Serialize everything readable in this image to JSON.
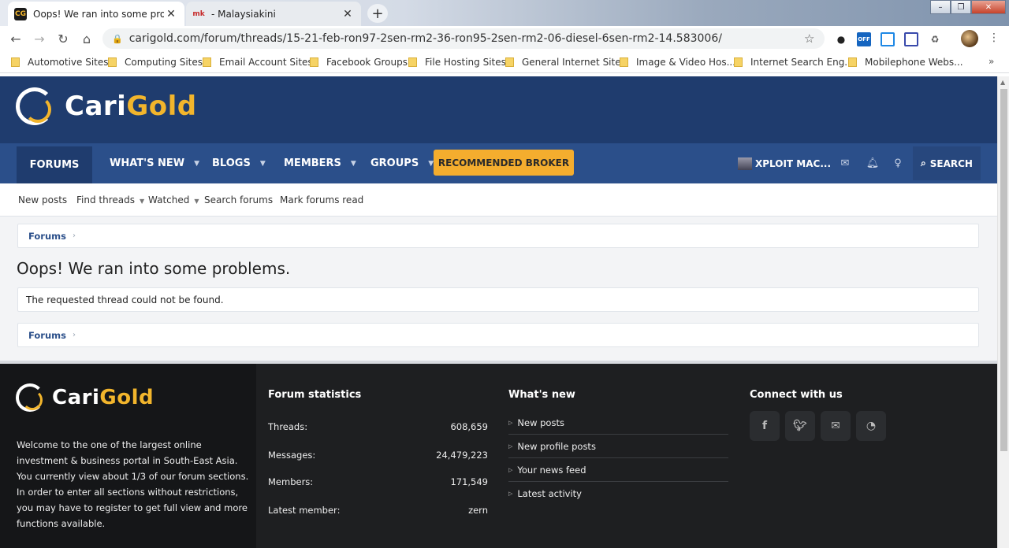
{
  "browser": {
    "tabs": [
      {
        "title": "Oops! We ran into some problem",
        "favicon": "CG"
      },
      {
        "title": "- Malaysiakini",
        "favicon": "mk"
      }
    ],
    "new_tab_glyph": "+",
    "close_glyph": "✕",
    "url": "carigold.com/forum/threads/15-21-feb-ron97-2sen-rm2-36-ron95-2sen-rm2-06-diesel-6sen-rm2-14.583006/",
    "extensions": {
      "off_badge": "OFF"
    },
    "bookmarks": [
      "Automotive Sites",
      "Computing Sites",
      "Email Account Sites",
      "Facebook Groups",
      "File Hosting Sites",
      "General Internet Sites",
      "Image & Video Hos...",
      "Internet Search Eng...",
      "Mobilephone Webs..."
    ],
    "bookmarks_more": "»"
  },
  "site": {
    "logo_part1": "Cari",
    "logo_part2": "Gold",
    "colors": {
      "header": "#1f3c6e",
      "nav": "#2b4f8a",
      "accent": "#f4ad2e",
      "footer": "#1e1f21"
    },
    "nav": {
      "forums": "FORUMS",
      "whats_new": "WHAT'S NEW",
      "blogs": "BLOGS",
      "members": "MEMBERS",
      "groups": "GROUPS",
      "broker": "RECOMMENDED BROKER",
      "user": "XPLOIT MAC...",
      "search": "SEARCH"
    },
    "subnav": {
      "new_posts": "New posts",
      "find_threads": "Find threads",
      "watched": "Watched",
      "search_forums": "Search forums",
      "mark_read": "Mark forums read"
    },
    "breadcrumb": "Forums",
    "page_title": "Oops! We ran into some problems.",
    "error_message": "The requested thread could not be found."
  },
  "footer": {
    "about": "Welcome to the one of the largest online investment & business portal in South-East Asia. You currently view about 1/3 of our forum sections. In order to enter all sections without restrictions, you may have to register to get full view and more functions available.",
    "stats_heading": "Forum statistics",
    "stats": [
      {
        "label": "Threads:",
        "value": "608,659"
      },
      {
        "label": "Messages:",
        "value": "24,479,223"
      },
      {
        "label": "Members:",
        "value": "171,549"
      },
      {
        "label": "Latest member:",
        "value": "zern"
      }
    ],
    "whats_new_heading": "What's new",
    "whats_new": [
      "New posts",
      "New profile posts",
      "Your news feed",
      "Latest activity"
    ],
    "connect_heading": "Connect with us",
    "social_icons": [
      "facebook-icon",
      "twitter-icon",
      "email-icon",
      "rss-icon"
    ]
  }
}
